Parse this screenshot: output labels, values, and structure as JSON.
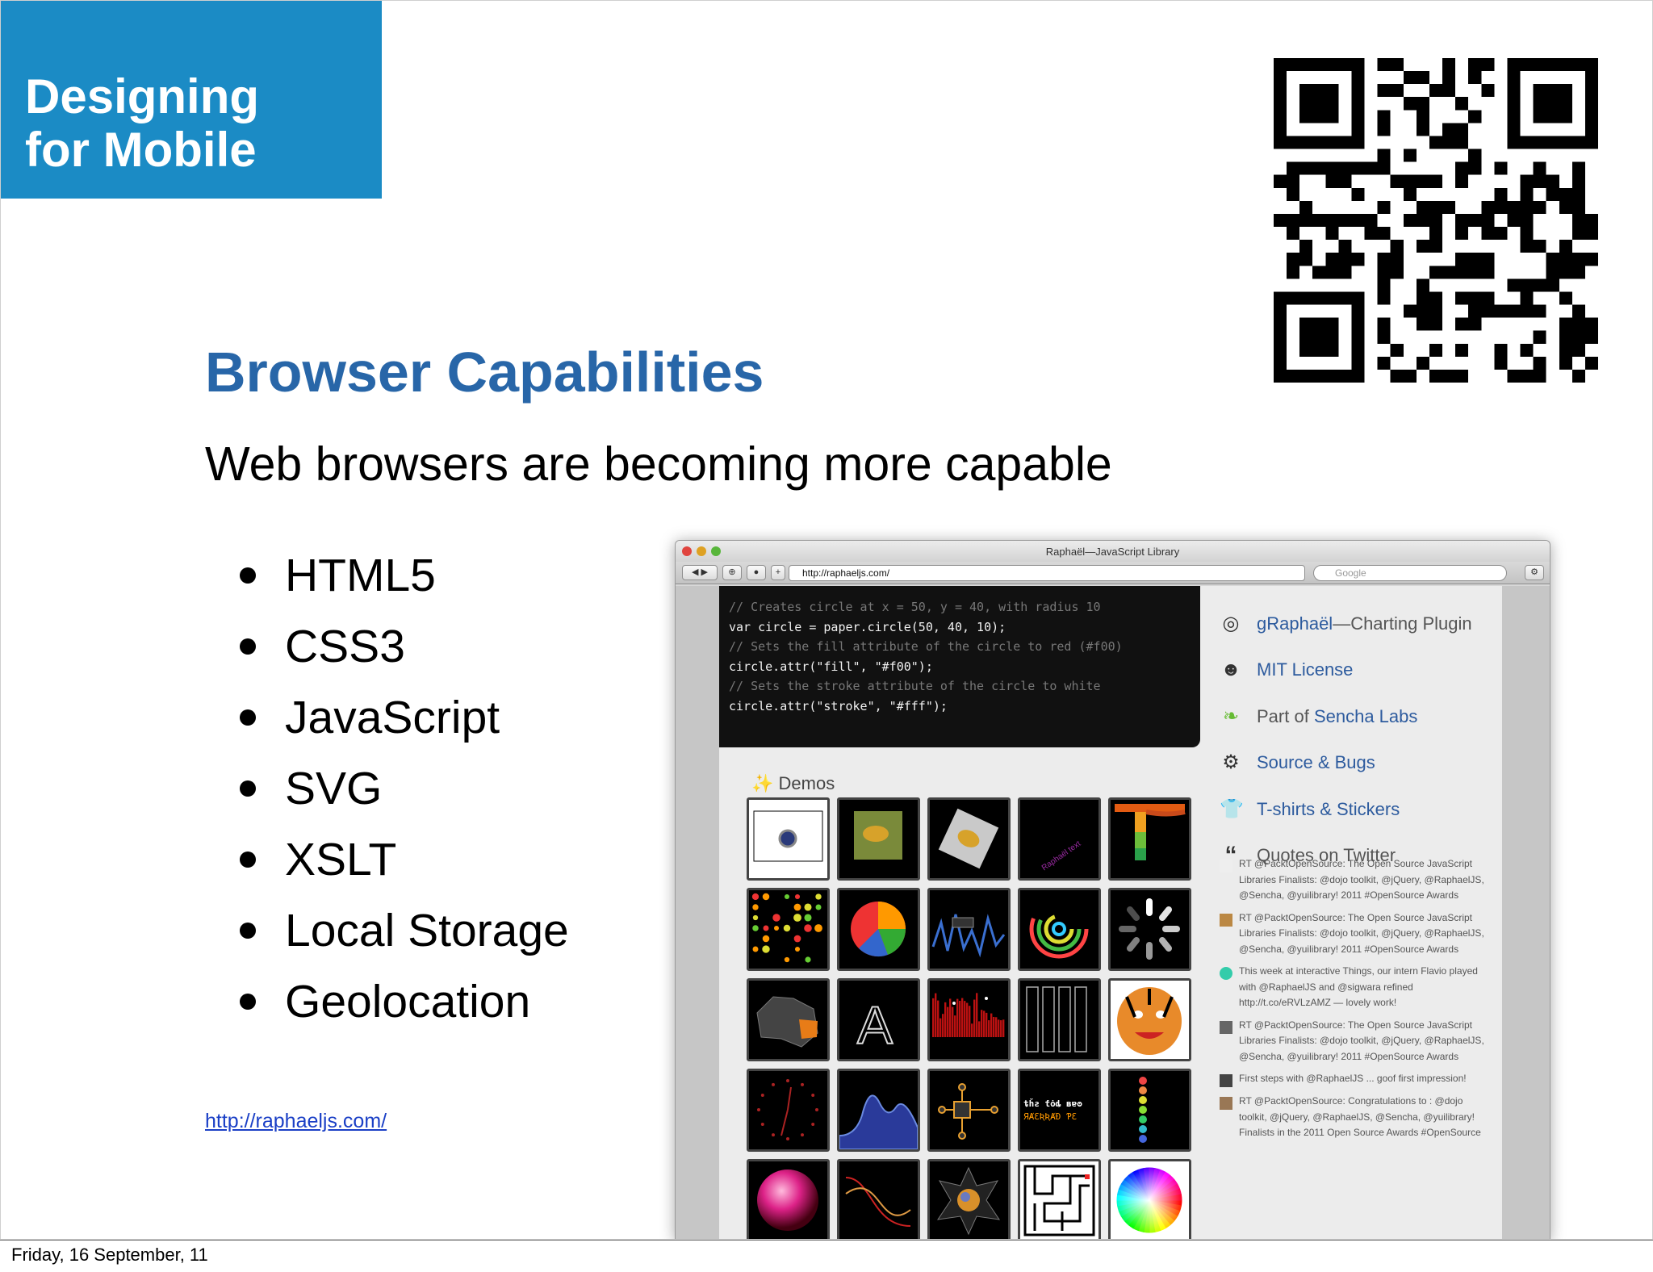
{
  "slide": {
    "section_title_line1": "Designing",
    "section_title_line2": "for Mobile",
    "heading": "Browser Capabilities",
    "subheading": "Web browsers are becoming more capable",
    "bullets": [
      "HTML5",
      "CSS3",
      "JavaScript",
      "SVG",
      "XSLT",
      "Local Storage",
      "Geolocation"
    ],
    "link": "http://raphaeljs.com/",
    "footer": "Friday, 16 September, 11",
    "colors": {
      "title_box": "#1b8bc5",
      "heading": "#2866a8",
      "link": "#1a3fc6"
    }
  },
  "browser": {
    "window_title": "Raphaël—JavaScript Library",
    "url": "http://raphaeljs.com/",
    "search_placeholder": "Google",
    "code_lines": [
      "// Creates circle at x = 50, y = 40, with radius 10",
      "var circle = paper.circle(50, 40, 10);",
      "// Sets the fill attribute of the circle to red (#f00)",
      "circle.attr(\"fill\", \"#f00\");",
      "",
      "// Sets the stroke attribute of the circle to white",
      "circle.attr(\"stroke\", \"#fff\");"
    ],
    "demos_label": "Demos",
    "sidebar": {
      "graphael": "gRaphaël",
      "graphael_suffix": "—Charting Plugin",
      "license": "MIT License",
      "part_of": "Part of",
      "sencha": "Sencha Labs",
      "source": "Source & Bugs",
      "tshirts": "T-shirts & Stickers",
      "quotes": "Quotes on Twitter"
    },
    "tweets": [
      "RT @PacktOpenSource: The Open Source JavaScript Libraries Finalists: @dojo toolkit, @jQuery, @RaphaelJS, @Sencha, @yuilibrary! 2011 #OpenSource Awards",
      "RT @PacktOpenSource: The Open Source JavaScript Libraries Finalists: @dojo toolkit, @jQuery, @RaphaelJS, @Sencha, @yuilibrary! 2011 #OpenSource Awards",
      "This week at interactive Things, our intern Flavio played with @RaphaelJS and @sigwara refined http://t.co/eRVLzAMZ — lovely work!",
      "RT @PacktOpenSource: The Open Source JavaScript Libraries Finalists: @dojo toolkit, @jQuery, @RaphaelJS, @Sencha, @yuilibrary! 2011 #OpenSource Awards",
      "First steps with @RaphaelJS ... goof first impression!",
      "RT @PacktOpenSource: Congratulations to : @dojo toolkit, @jQuery, @RaphaelJS, @Sencha, @yuilibrary! Finalists in the 2011 Open Source Awards #OpenSource"
    ]
  }
}
